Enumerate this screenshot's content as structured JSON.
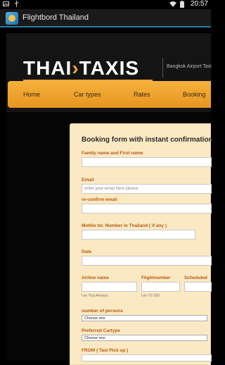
{
  "status_bar": {
    "time": "20:57"
  },
  "app": {
    "title": "Flightbord Thailand"
  },
  "site": {
    "logo_part1": "THAI",
    "logo_part2": "TAXIS",
    "tagline": "Bangkok Airport Taxi"
  },
  "nav": {
    "items": [
      "Home",
      "Car types",
      "Rates",
      "Booking"
    ]
  },
  "form": {
    "title": "Booking form with instant confirmation",
    "family_name_label": "Family name and First name",
    "email_label": "Email",
    "email_placeholder": "enter your email here please",
    "reconfirm_label": "re-confirm email",
    "mobile_label": "Mobile tel. Number in Thailand ( if any )",
    "date_label": "Date",
    "airline_label": "Airline name",
    "airline_hint": "f.ex Thai Airways",
    "flightnumber_label": "Flightnumber",
    "flightnumber_hint": "f.ex TG 935",
    "scheduled_label": "Scheduled",
    "persons_label": "number of persons",
    "persons_value": "Choose one",
    "cartype_label": "Preferred Cartype",
    "cartype_value": "Choose one",
    "from_label": "FROM ( Taxi Pick up )"
  }
}
